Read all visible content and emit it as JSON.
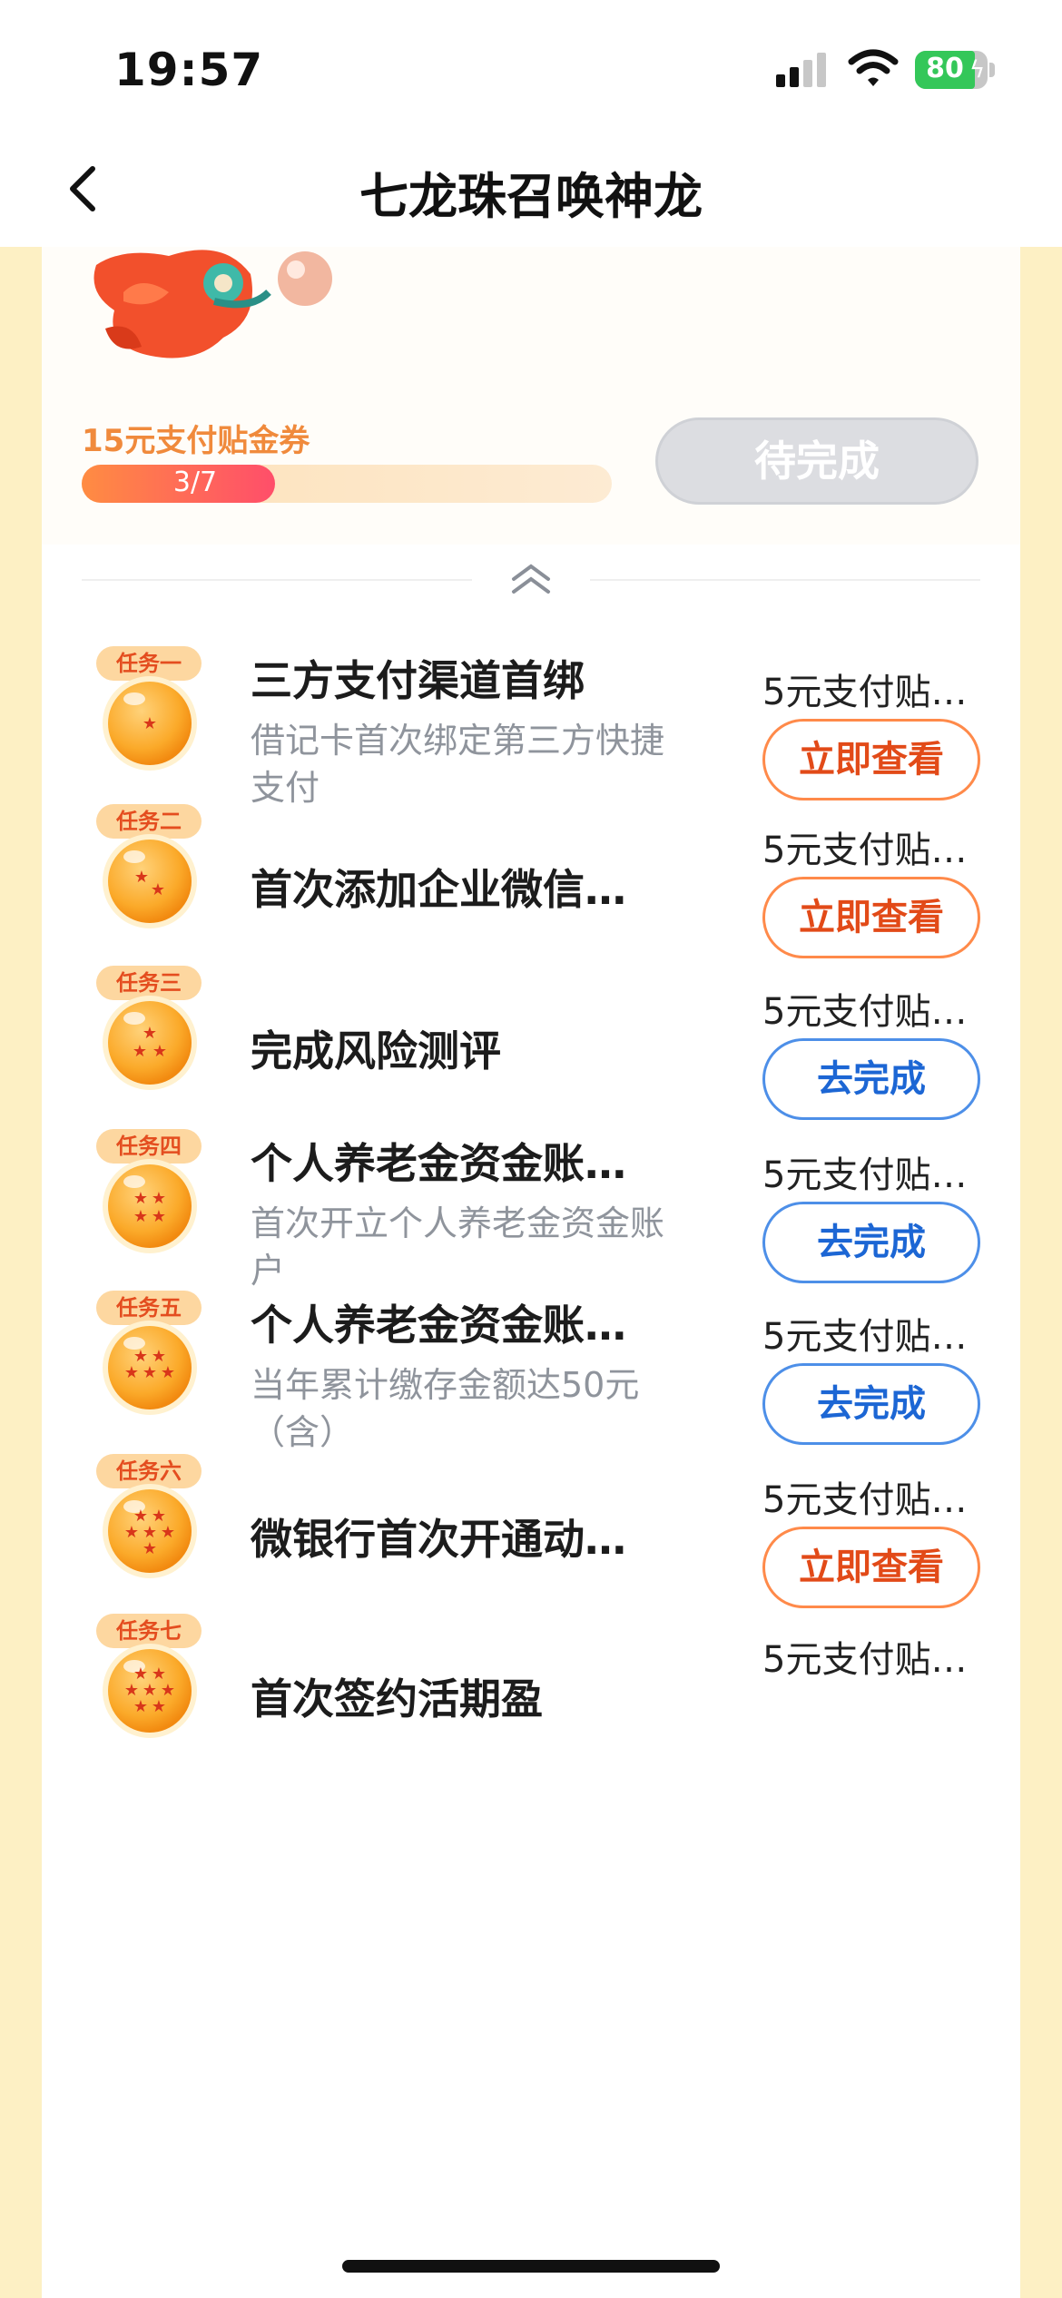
{
  "status_bar": {
    "time": "19:57",
    "battery": "80",
    "icons": [
      "signal-icon",
      "wifi-icon",
      "battery-icon"
    ]
  },
  "nav": {
    "title": "七龙珠召唤神龙",
    "back_icon": "chevron-left-icon"
  },
  "header": {
    "reward_label": "15元支付贴金券",
    "progress_text": "3/7",
    "progress_fraction": 0.43,
    "pending_button": "待完成",
    "collapse_icon": "double-chevron-up-icon"
  },
  "tasks": [
    {
      "badge": "任务一",
      "stars": 1,
      "title": "三方支付渠道首绑",
      "desc": "借记卡首次绑定第三方快捷支付",
      "reward": "5元支付贴…",
      "button": "立即查看",
      "button_type": "view"
    },
    {
      "badge": "任务二",
      "stars": 2,
      "title": "首次添加企业微信…",
      "desc": "",
      "reward": "5元支付贴…",
      "button": "立即查看",
      "button_type": "view"
    },
    {
      "badge": "任务三",
      "stars": 3,
      "title": "完成风险测评",
      "desc": "",
      "reward": "5元支付贴…",
      "button": "去完成",
      "button_type": "do"
    },
    {
      "badge": "任务四",
      "stars": 4,
      "title": "个人养老金资金账…",
      "desc": "首次开立个人养老金资金账户",
      "reward": "5元支付贴…",
      "button": "去完成",
      "button_type": "do"
    },
    {
      "badge": "任务五",
      "stars": 5,
      "title": "个人养老金资金账…",
      "desc": "当年累计缴存金额达50元（含）",
      "reward": "5元支付贴…",
      "button": "去完成",
      "button_type": "do"
    },
    {
      "badge": "任务六",
      "stars": 6,
      "title": "微银行首次开通动…",
      "desc": "",
      "reward": "5元支付贴…",
      "button": "立即查看",
      "button_type": "view"
    },
    {
      "badge": "任务七",
      "stars": 7,
      "title": "首次签约活期盈",
      "desc": "",
      "reward": "5元支付贴…",
      "button": "",
      "button_type": "do"
    }
  ],
  "colors": {
    "page_bg": "#fdf0c4",
    "accent_orange": "#f08a3c",
    "view_button": "#e24a18",
    "do_button": "#1c66d4"
  }
}
